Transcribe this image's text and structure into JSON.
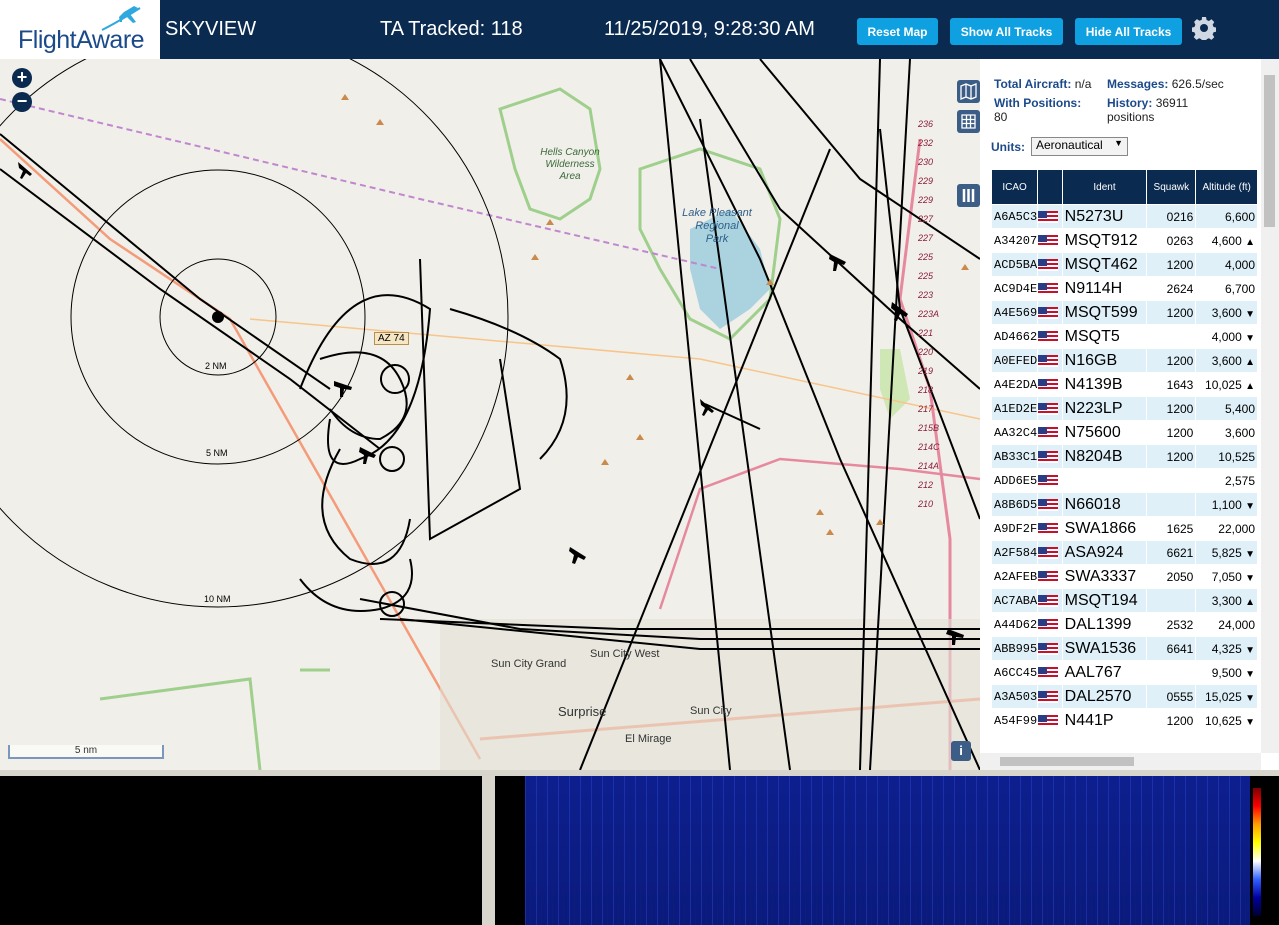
{
  "header": {
    "brand": "FlightAware",
    "app_name": "SKYVIEW",
    "tracked_label": "TA Tracked: 118",
    "datetime": "11/25/2019, 9:28:30 AM",
    "buttons": {
      "reset_map": "Reset Map",
      "show_all_tracks": "Show All Tracks",
      "hide_all_tracks": "Hide All Tracks"
    }
  },
  "map": {
    "zoom_in": "+",
    "zoom_out": "−",
    "scale_label": "5 nm",
    "info_label": "i",
    "range_rings": [
      "2 NM",
      "5 NM",
      "10 NM"
    ],
    "places": {
      "hells_canyon": [
        "Hells Canyon",
        "Wilderness",
        "Area"
      ],
      "lake_pleasant": [
        "Lake Pleasant",
        "Regional",
        "Park"
      ],
      "sun_city_grand": "Sun City Grand",
      "sun_city_west": "Sun City West",
      "surprise": "Surprise",
      "sun_city": "Sun City",
      "el_mirage": "El Mirage",
      "az74": "AZ 74"
    },
    "exit_numbers": [
      "236",
      "232",
      "230",
      "229",
      "229",
      "227",
      "227",
      "225",
      "225",
      "223",
      "223A",
      "221",
      "220",
      "219",
      "218",
      "217",
      "215B",
      "214C",
      "214A",
      "212",
      "210"
    ]
  },
  "sidebar": {
    "total_aircraft_label": "Total Aircraft:",
    "total_aircraft_value": "n/a",
    "messages_label": "Messages:",
    "messages_value": "626.5/sec",
    "with_positions_label": "With Positions:",
    "with_positions_value": "80",
    "history_label": "History:",
    "history_value": "36911",
    "history_unit": "positions",
    "units_label": "Units:",
    "units_value": "Aeronautical",
    "columns": [
      "ICAO",
      "",
      "Ident",
      "Squawk",
      "Altitude (ft)"
    ],
    "rows": [
      {
        "icao": "A6A5C3",
        "ident": "N5273U",
        "squawk": "0216",
        "alt": "6,600",
        "trend": ""
      },
      {
        "icao": "A34207",
        "ident": "MSQT912",
        "squawk": "0263",
        "alt": "4,600",
        "trend": "▲"
      },
      {
        "icao": "ACD5BA",
        "ident": "MSQT462",
        "squawk": "1200",
        "alt": "4,000",
        "trend": ""
      },
      {
        "icao": "AC9D4E",
        "ident": "N9114H",
        "squawk": "2624",
        "alt": "6,700",
        "trend": ""
      },
      {
        "icao": "A4E569",
        "ident": "MSQT599",
        "squawk": "1200",
        "alt": "3,600",
        "trend": "▼"
      },
      {
        "icao": "AD4662",
        "ident": "MSQT5",
        "squawk": "",
        "alt": "4,000",
        "trend": "▼"
      },
      {
        "icao": "A0EFED",
        "ident": "N16GB",
        "squawk": "1200",
        "alt": "3,600",
        "trend": "▲"
      },
      {
        "icao": "A4E2DA",
        "ident": "N4139B",
        "squawk": "1643",
        "alt": "10,025",
        "trend": "▲"
      },
      {
        "icao": "A1ED2E",
        "ident": "N223LP",
        "squawk": "1200",
        "alt": "5,400",
        "trend": ""
      },
      {
        "icao": "AA32C4",
        "ident": "N75600",
        "squawk": "1200",
        "alt": "3,600",
        "trend": ""
      },
      {
        "icao": "AB33C1",
        "ident": "N8204B",
        "squawk": "1200",
        "alt": "10,525",
        "trend": ""
      },
      {
        "icao": "ADD6E5",
        "ident": "",
        "squawk": "",
        "alt": "2,575",
        "trend": ""
      },
      {
        "icao": "A8B6D5",
        "ident": "N66018",
        "squawk": "",
        "alt": "1,100",
        "trend": "▼"
      },
      {
        "icao": "A9DF2F",
        "ident": "SWA1866",
        "squawk": "1625",
        "alt": "22,000",
        "trend": ""
      },
      {
        "icao": "A2F584",
        "ident": "ASA924",
        "squawk": "6621",
        "alt": "5,825",
        "trend": "▼"
      },
      {
        "icao": "A2AFEB",
        "ident": "SWA3337",
        "squawk": "2050",
        "alt": "7,050",
        "trend": "▼"
      },
      {
        "icao": "AC7ABA",
        "ident": "MSQT194",
        "squawk": "",
        "alt": "3,300",
        "trend": "▲"
      },
      {
        "icao": "A44D62",
        "ident": "DAL1399",
        "squawk": "2532",
        "alt": "24,000",
        "trend": ""
      },
      {
        "icao": "ABB995",
        "ident": "SWA1536",
        "squawk": "6641",
        "alt": "4,325",
        "trend": "▼"
      },
      {
        "icao": "A6CC45",
        "ident": "AAL767",
        "squawk": "",
        "alt": "9,500",
        "trend": "▼"
      },
      {
        "icao": "A3A503",
        "ident": "DAL2570",
        "squawk": "0555",
        "alt": "15,025",
        "trend": "▼"
      },
      {
        "icao": "A54F99",
        "ident": "N441P",
        "squawk": "1200",
        "alt": "10,625",
        "trend": "▼"
      }
    ]
  },
  "colors": {
    "header_bg": "#0a2a50",
    "button_bg": "#0ea0e0",
    "row_alt": "#dff0f8",
    "water": "#aad3df",
    "park_border": "#9fcf8c"
  }
}
